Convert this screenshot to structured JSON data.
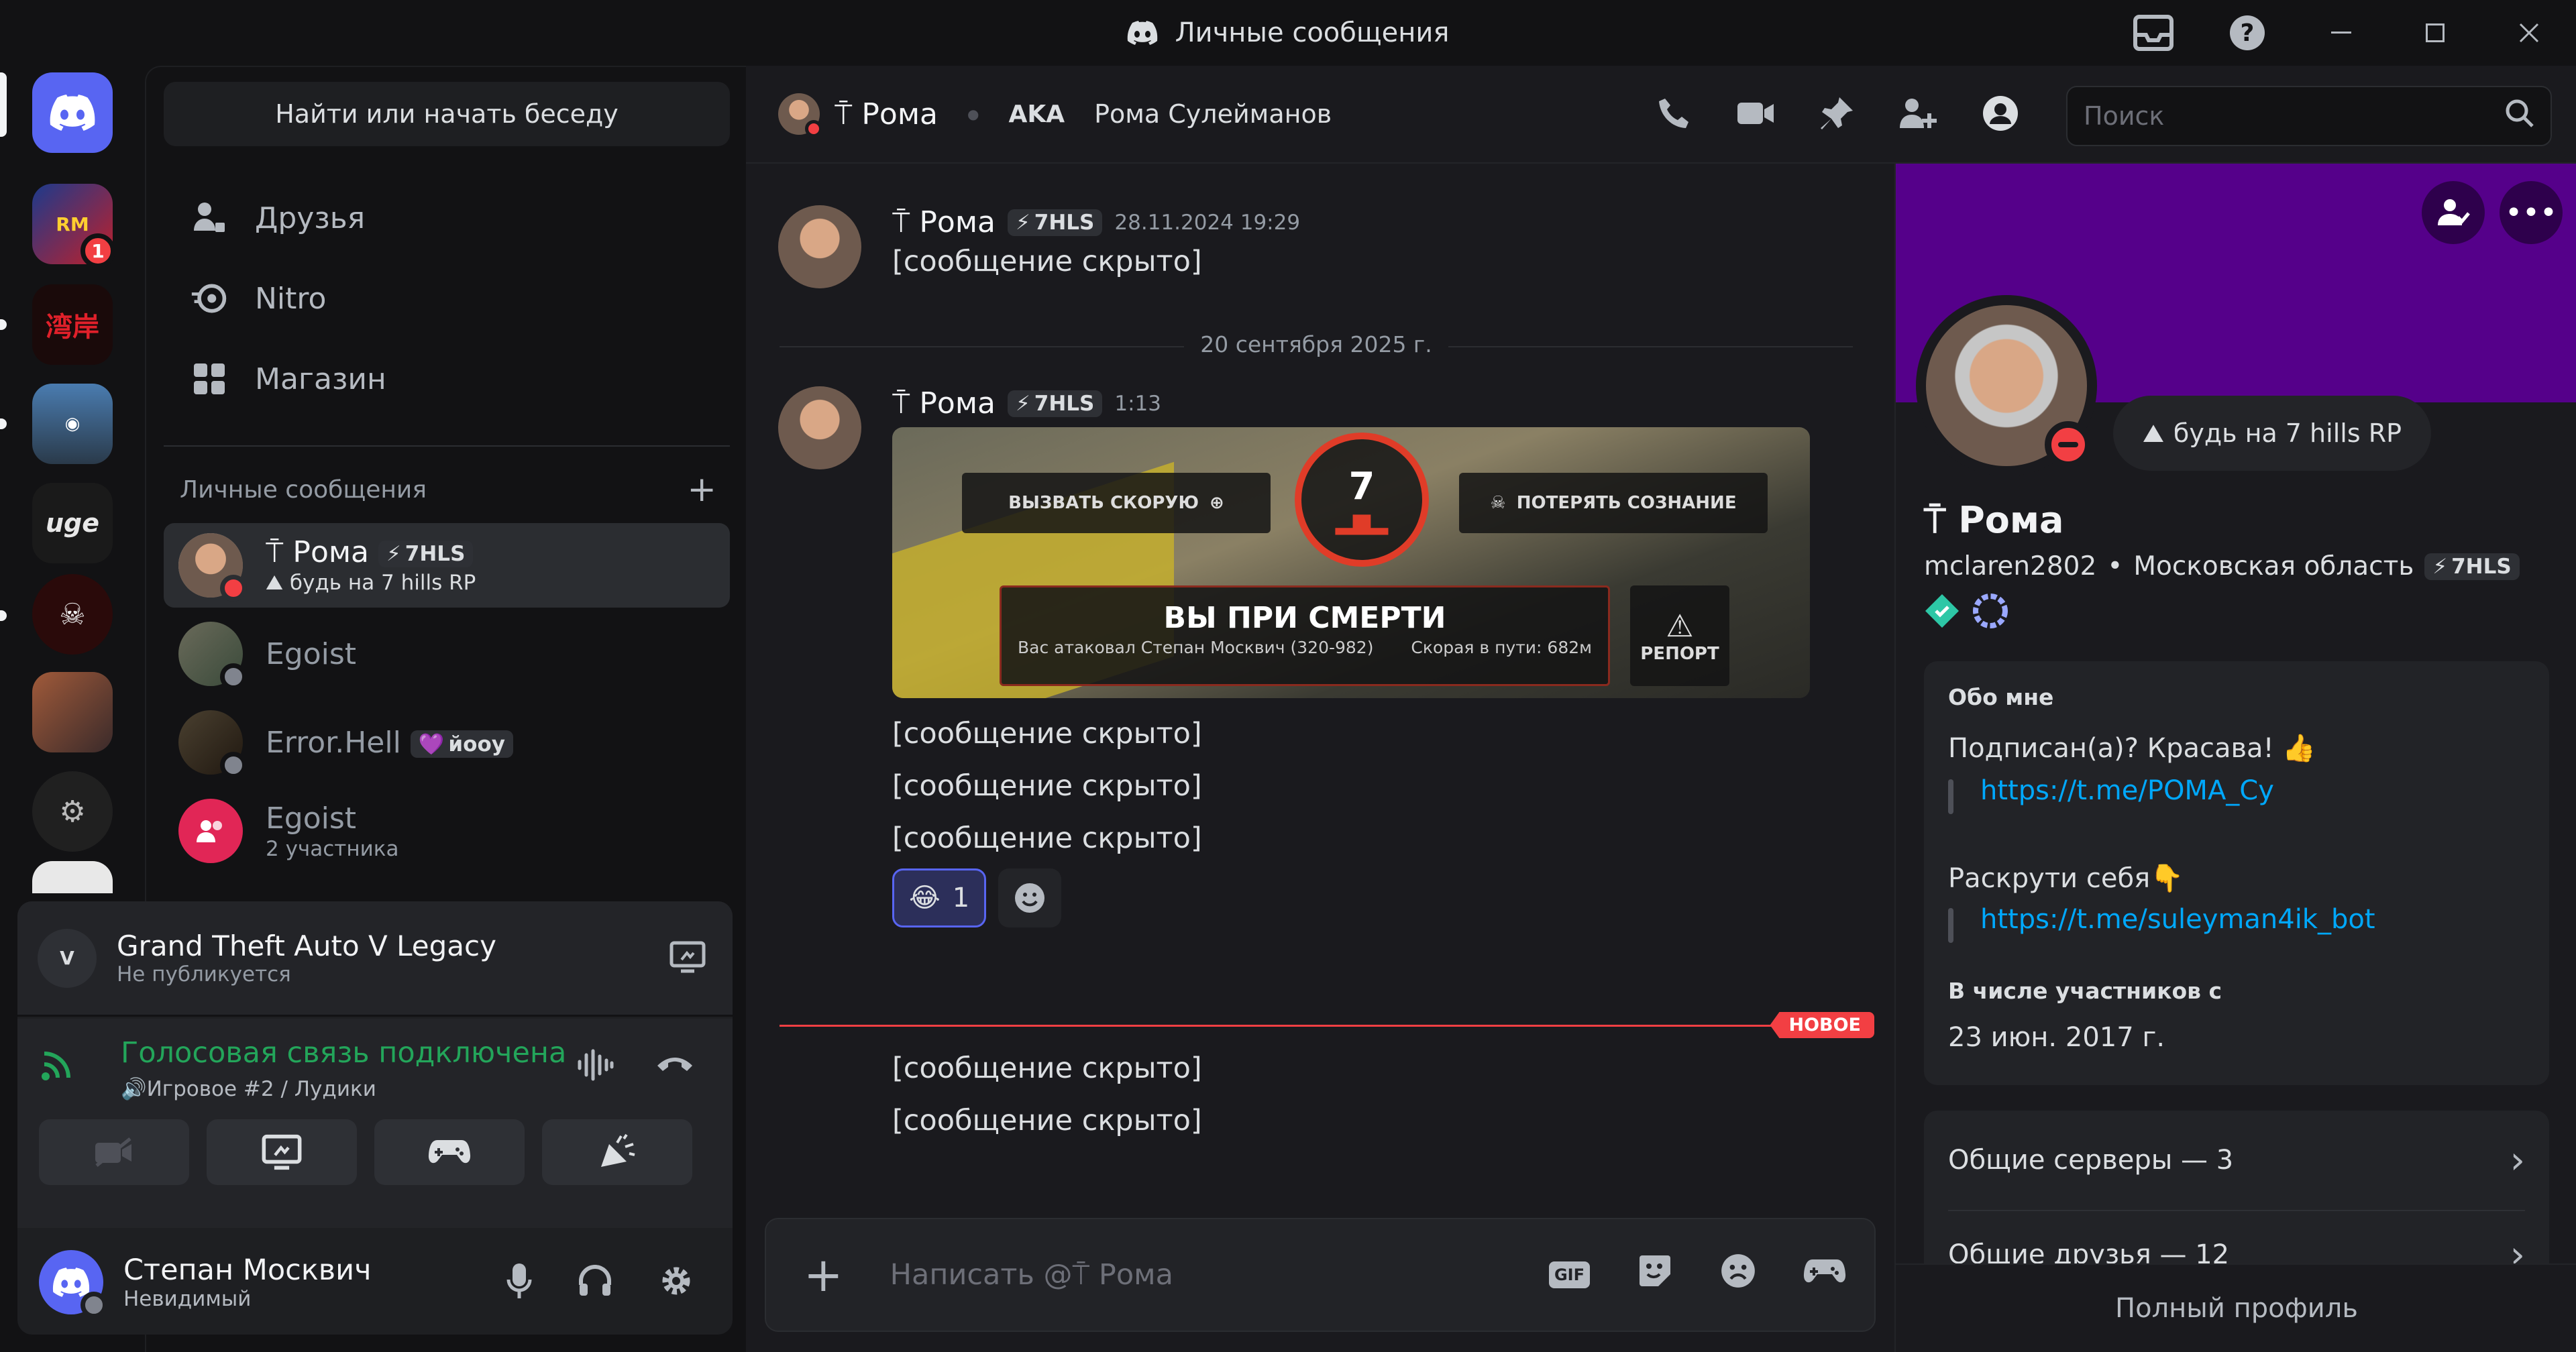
{
  "titlebar": {
    "title": "Личные сообщения",
    "icons": [
      "inbox-icon",
      "help-icon",
      "minimize-icon",
      "maximize-icon",
      "close-icon"
    ]
  },
  "servers": {
    "discord_home": "discord-home-icon",
    "badge_count": "1",
    "items": [
      "server-rm",
      "server-red",
      "server-city",
      "server-uge",
      "server-skull",
      "server-avatar",
      "server-gear",
      "server-number"
    ]
  },
  "dm": {
    "search_label": "Найти или начать беседу",
    "nav": [
      {
        "label": "Друзья",
        "icon": "friends-icon"
      },
      {
        "label": "Nitro",
        "icon": "nitro-icon"
      },
      {
        "label": "Магазин",
        "icon": "shop-icon"
      }
    ],
    "section_title": "Личные сообщения",
    "add": "+",
    "items": [
      {
        "name": "Рома",
        "prefix": "⍑",
        "tag": "7HLS",
        "status": "будь на 7 hills RP",
        "selected": true
      },
      {
        "name": "Egoist"
      },
      {
        "name": "Error.Hell",
        "tag": "йоoy"
      },
      {
        "name": "Egoist",
        "status": "2 участника"
      }
    ]
  },
  "panel": {
    "game_title": "Grand Theft Auto V Legacy",
    "game_sub": "Не публикуется",
    "voice_title": "Голосовая связь подключена",
    "voice_sub": "Игровое #2 / Лудики",
    "user_name": "Степан Москвич",
    "user_status": "Невидимый"
  },
  "header": {
    "name": "Рома",
    "aka_label": "AKA",
    "aka_name": "Рома Сулейманов",
    "search_placeholder": "Поиск"
  },
  "messages": [
    {
      "author": "Рома",
      "tag": "7HLS",
      "time": "28.11.2024 19:29",
      "lines": [
        "[сообщение скрыто]"
      ]
    },
    {
      "divider": "20 сентября 2025 г."
    },
    {
      "author": "Рома",
      "tag": "7HLS",
      "time": "1:13",
      "image": {
        "call_ambulance": "ВЫЗВАТЬ СКОРУЮ",
        "countdown": "7",
        "lose_consc": "ПОТЕРЯТЬ СОЗНАНИЕ",
        "title": "ВЫ ПРИ СМЕРТИ",
        "attacker": "Вас атаковал Степан Москвич (320-982)",
        "ambulance": "Скорая в пути: 682м",
        "report": "РЕПОРТ"
      },
      "lines": [
        "[сообщение скрыто]",
        "[сообщение скрыто]",
        "[сообщение скрыто]"
      ],
      "reaction": {
        "emoji": "😂",
        "count": "1"
      }
    },
    {
      "new_label": "НОВОЕ"
    },
    {
      "lines": [
        "[сообщение скрыто]",
        "[сообщение скрыто]"
      ]
    }
  ],
  "composer": {
    "placeholder": "Написать @⍑ Рома",
    "gif": "GIF"
  },
  "profile": {
    "status": "будь на 7 hills RP",
    "name": "Рома",
    "username": "mclaren2802",
    "location": "Московская область",
    "tag": "7HLS",
    "about_title": "Обо мне",
    "about_line1": "Подписан(а)? Красава!",
    "link1": "https://t.me/POMA_Cy",
    "about_line2": "Раскрути себя",
    "link2": "https://t.me/suleyman4ik_bot",
    "member_since_title": "В числе участников с",
    "member_since": "23 июн. 2017 г.",
    "mutual_servers": "Общие серверы — 3",
    "mutual_friends": "Общие друзья — 12",
    "full_profile": "Полный профиль"
  },
  "colors": {
    "accent": "#5865f2",
    "online_red": "#f23f43",
    "voice_green": "#23a55a",
    "banner": "#55008a",
    "link": "#00a8fc"
  }
}
